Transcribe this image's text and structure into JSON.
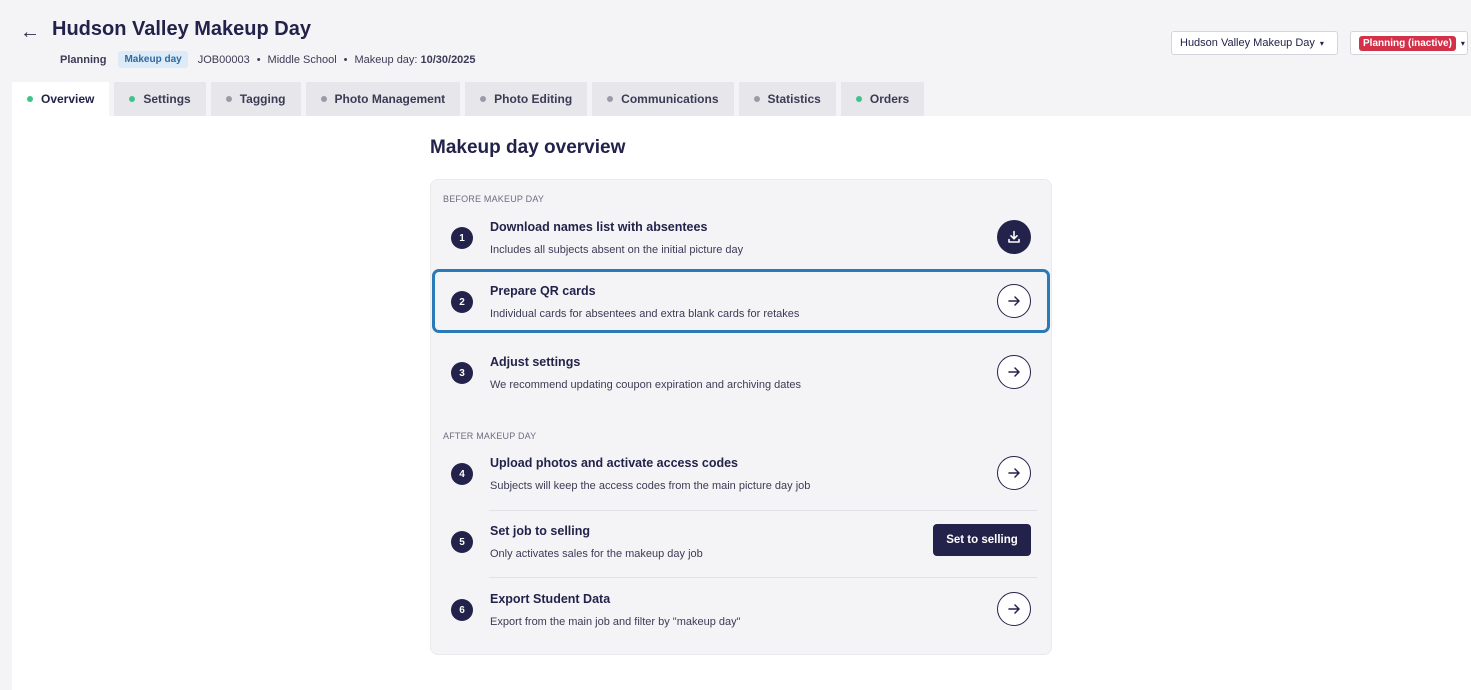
{
  "header": {
    "back_icon": "arrow-left-icon",
    "title": "Hudson Valley Makeup Day",
    "meta": {
      "planning": "Planning",
      "badge": "Makeup day",
      "job_id": "JOB00003",
      "separator": "•",
      "school": "Middle School",
      "date_label": "Makeup day:",
      "date": "10/30/2025"
    },
    "job_select": {
      "value": "Hudson Valley Makeup Day",
      "caret": "▾"
    },
    "status_select": {
      "value": "Planning (inactive)",
      "caret": "▾",
      "color": "#d3304a"
    }
  },
  "tabs": [
    {
      "label": "Overview",
      "status": "green",
      "active": true
    },
    {
      "label": "Settings",
      "status": "green",
      "active": false
    },
    {
      "label": "Tagging",
      "status": "gray",
      "active": false
    },
    {
      "label": "Photo Management",
      "status": "gray",
      "active": false
    },
    {
      "label": "Photo Editing",
      "status": "gray",
      "active": false
    },
    {
      "label": "Communications",
      "status": "gray",
      "active": false
    },
    {
      "label": "Statistics",
      "status": "gray",
      "active": false
    },
    {
      "label": "Orders",
      "status": "green",
      "active": false
    }
  ],
  "overview": {
    "title": "Makeup day overview",
    "before_label": "BEFORE MAKEUP DAY",
    "after_label": "AFTER MAKEUP DAY",
    "steps": [
      {
        "num": "1",
        "title": "Download names list with absentees",
        "desc": "Includes all subjects absent on the initial picture day",
        "action": "download-icon"
      },
      {
        "num": "2",
        "title": "Prepare QR cards",
        "desc": "Individual cards for absentees and extra blank cards for retakes",
        "action": "arrow-right-icon"
      },
      {
        "num": "3",
        "title": "Adjust settings",
        "desc": "We recommend updating coupon expiration and archiving dates",
        "action": "arrow-right-icon"
      },
      {
        "num": "4",
        "title": "Upload photos and activate access codes",
        "desc": "Subjects will keep the access codes from the main picture day job",
        "action": "arrow-right-icon"
      },
      {
        "num": "5",
        "title": "Set job to selling",
        "desc": "Only activates sales for the makeup day job",
        "button_label": "Set to selling"
      },
      {
        "num": "6",
        "title": "Export Student Data",
        "desc": "Export from the main job and filter by \"makeup day\"",
        "action": "arrow-right-icon"
      }
    ]
  },
  "colors": {
    "primary": "#23224a",
    "highlight": "#2a7ab8",
    "status_green": "#3ec48b",
    "status_gray": "#9b9aa8"
  }
}
